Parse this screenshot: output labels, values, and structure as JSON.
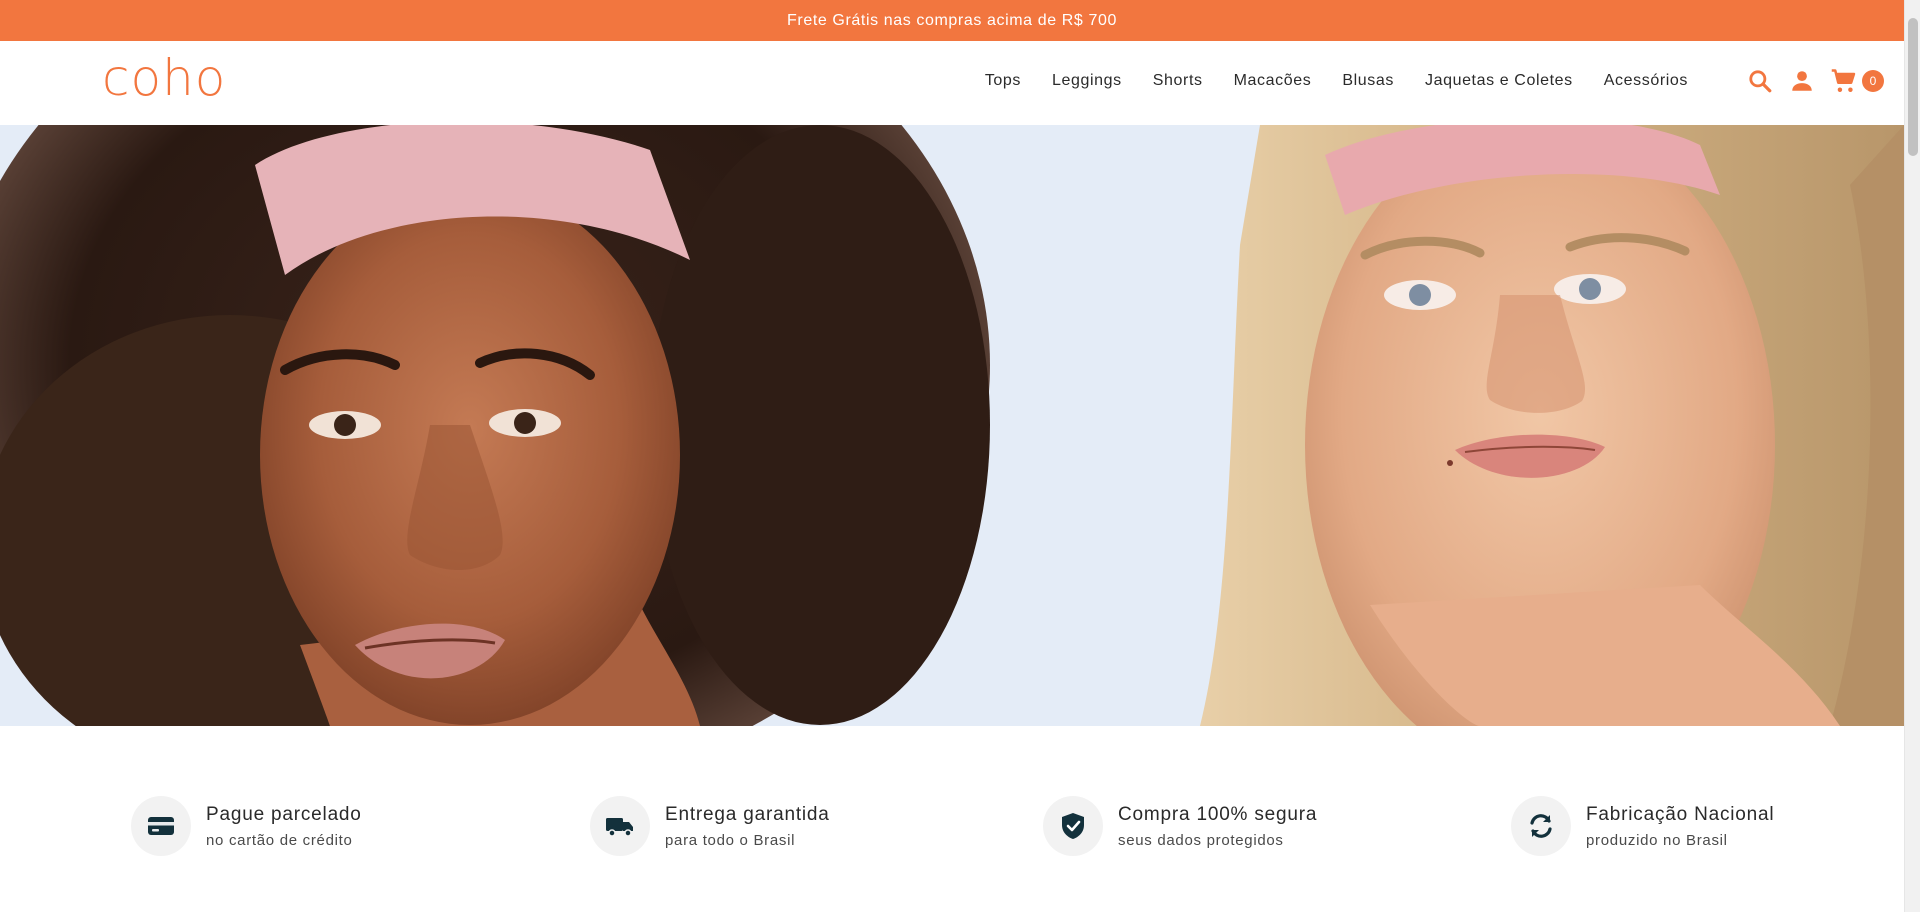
{
  "announcement": {
    "text": "Frete Grátis nas compras acima de R$ 700"
  },
  "header": {
    "logo": "coho",
    "nav": [
      {
        "label": "Tops"
      },
      {
        "label": "Leggings"
      },
      {
        "label": "Shorts"
      },
      {
        "label": "Macacões"
      },
      {
        "label": "Blusas"
      },
      {
        "label": "Jaquetas e Coletes"
      },
      {
        "label": "Acessórios"
      }
    ],
    "icons": {
      "search": "search-icon",
      "account": "user-icon",
      "cart": "cart-icon"
    },
    "cart_count": "0"
  },
  "hero": {
    "image_alt": "hero-image"
  },
  "benefits": [
    {
      "title": "Pague parcelado",
      "subtitle": "no cartão de crédito",
      "icon": "credit-card-icon"
    },
    {
      "title": "Entrega garantida",
      "subtitle": "para todo o Brasil",
      "icon": "truck-icon"
    },
    {
      "title": "Compra 100% segura",
      "subtitle": "seus dados protegidos",
      "icon": "shield-check-icon"
    },
    {
      "title": "Fabricação Nacional",
      "subtitle": "produzido no Brasil",
      "icon": "refresh-icon"
    }
  ],
  "colors": {
    "accent": "#F2763F",
    "text_dark": "#2a2a2a",
    "icon_dark": "#13313c"
  }
}
